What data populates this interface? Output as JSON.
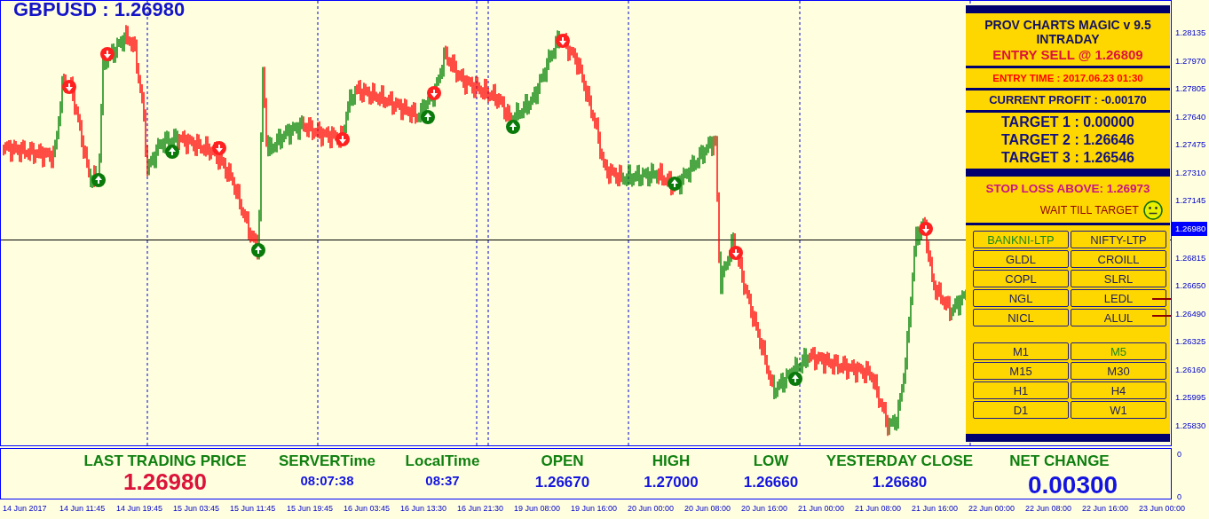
{
  "chart": {
    "title": "GBPUSD : 1.26980"
  },
  "panel": {
    "title": "PROV CHARTS MAGIC v 9.5",
    "subtitle": "INTRADAY",
    "entry": "ENTRY SELL @ 1.26809",
    "entry_time": "ENTRY TIME : 2017.06.23 01:30",
    "profit": "CURRENT PROFIT : -0.00170",
    "targets": [
      "TARGET 1 : 0.00000",
      "TARGET 2 : 1.26646",
      "TARGET 3 : 1.26546"
    ],
    "stop_loss": "STOP LOSS ABOVE: 1.26973",
    "status": "WAIT TILL TARGET",
    "symbols": [
      {
        "label": "BANKNI-LTP",
        "selected": true
      },
      {
        "label": "NIFTY-LTP",
        "selected": false
      },
      {
        "label": "GLDL",
        "selected": false
      },
      {
        "label": "CROILL",
        "selected": false
      },
      {
        "label": "COPL",
        "selected": false
      },
      {
        "label": "SLRL",
        "selected": false
      },
      {
        "label": "NGL",
        "selected": false
      },
      {
        "label": "LEDL",
        "selected": false
      },
      {
        "label": "NICL",
        "selected": false
      },
      {
        "label": "ALUL",
        "selected": false
      }
    ],
    "timeframes": [
      {
        "label": "M1",
        "selected": false
      },
      {
        "label": "M5",
        "selected": true
      },
      {
        "label": "M15",
        "selected": false
      },
      {
        "label": "M30",
        "selected": false
      },
      {
        "label": "H1",
        "selected": false
      },
      {
        "label": "H4",
        "selected": false
      },
      {
        "label": "D1",
        "selected": false
      },
      {
        "label": "W1",
        "selected": false
      }
    ]
  },
  "stats": [
    {
      "label": "LAST TRADING PRICE",
      "value": "1.26980",
      "kind": "big-red"
    },
    {
      "label": "SERVERTime",
      "value": "08:07:38",
      "kind": "small"
    },
    {
      "label": "LocalTime",
      "value": "08:37",
      "kind": "small"
    },
    {
      "label": "OPEN",
      "value": "1.26670",
      "kind": "normal"
    },
    {
      "label": "HIGH",
      "value": "1.27000",
      "kind": "normal"
    },
    {
      "label": "LOW",
      "value": "1.26660",
      "kind": "normal"
    },
    {
      "label": "YESTERDAY CLOSE",
      "value": "1.26680",
      "kind": "normal"
    },
    {
      "label": "NET CHANGE",
      "value": "0.00300",
      "kind": "big-blue"
    }
  ],
  "price_axis": [
    {
      "label": "1.28135",
      "highlighted": false
    },
    {
      "label": "1.27970",
      "highlighted": false
    },
    {
      "label": "1.27805",
      "highlighted": false
    },
    {
      "label": "1.27640",
      "highlighted": false
    },
    {
      "label": "1.27475",
      "highlighted": false
    },
    {
      "label": "1.27310",
      "highlighted": false
    },
    {
      "label": "1.27145",
      "highlighted": false
    },
    {
      "label": "1.26980",
      "highlighted": true
    },
    {
      "label": "1.26815",
      "highlighted": false
    },
    {
      "label": "1.26650",
      "highlighted": false
    },
    {
      "label": "1.26490",
      "highlighted": false
    },
    {
      "label": "1.26325",
      "highlighted": false
    },
    {
      "label": "1.26160",
      "highlighted": false
    },
    {
      "label": "1.25995",
      "highlighted": false
    },
    {
      "label": "1.25830",
      "highlighted": false
    }
  ],
  "sub_axis": [
    "0",
    "0"
  ],
  "time_axis": [
    "14 Jun 2017",
    "14 Jun 11:45",
    "14 Jun 19:45",
    "15 Jun 03:45",
    "15 Jun 11:45",
    "15 Jun 19:45",
    "16 Jun 03:45",
    "16 Jun 13:30",
    "16 Jun 21:30",
    "19 Jun 08:00",
    "19 Jun 16:00",
    "20 Jun 00:00",
    "20 Jun 08:00",
    "20 Jun 16:00",
    "21 Jun 00:00",
    "21 Jun 08:00",
    "21 Jun 16:00",
    "22 Jun 00:00",
    "22 Jun 08:00",
    "22 Jun 16:00",
    "23 Jun 00:00"
  ]
}
